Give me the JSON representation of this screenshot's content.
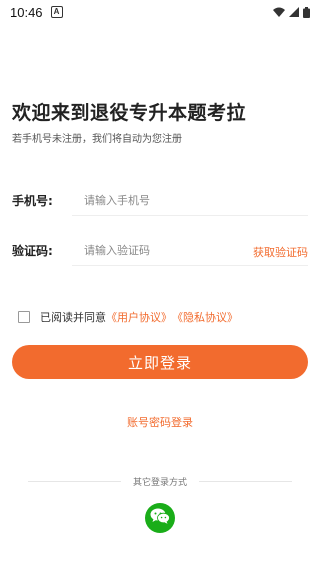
{
  "status_bar": {
    "time": "10:46",
    "notification_icon": "a-icon",
    "icons": [
      "wifi-icon",
      "signal-icon",
      "battery-icon"
    ]
  },
  "header": {
    "title": "欢迎来到退役专升本题考拉",
    "subtitle": "若手机号未注册，我们将自动为您注册"
  },
  "form": {
    "phone": {
      "label": "手机号:",
      "placeholder": "请输入手机号",
      "value": ""
    },
    "code": {
      "label": "验证码:",
      "placeholder": "请输入验证码",
      "value": "",
      "get_code_label": "获取验证码"
    }
  },
  "agreement": {
    "checked": false,
    "prefix": "已阅读并同意",
    "user_agreement": "《用户协议》",
    "privacy_policy": "《隐私协议》"
  },
  "actions": {
    "login_label": "立即登录",
    "password_login_label": "账号密码登录"
  },
  "other_login": {
    "label": "其它登录方式",
    "methods": [
      "wechat-icon"
    ]
  },
  "colors": {
    "accent": "#f26b2e",
    "wechat": "#1aad19"
  }
}
